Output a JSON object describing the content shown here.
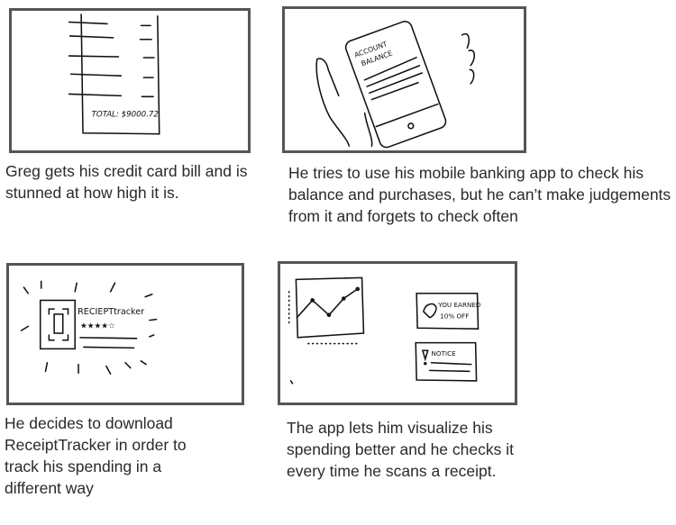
{
  "panels": [
    {
      "sketch_text": {
        "total": "TOTAL: $9000.72"
      },
      "caption": "Greg gets his credit card bill and is stunned at how high it is."
    },
    {
      "sketch_text": {
        "screen_title_1": "ACCOUNT",
        "screen_title_2": "BALANCE"
      },
      "caption": "He tries to use his mobile banking app to check his balance and purchases, but he can’t make judgements from it and forgets to check often"
    },
    {
      "sketch_text": {
        "app_name": "RECIEPTtracker",
        "rating": "★★★★☆"
      },
      "caption": "He decides to download ReceiptTracker in order to track his spending in a different way"
    },
    {
      "sketch_text": {
        "reward_1": "YOU EARNED",
        "reward_2": "10% OFF",
        "notice": "NOTICE"
      },
      "caption": "The app lets him visualize his spending better and he checks it every time he scans a receipt."
    }
  ],
  "colors": {
    "frame": "#555555",
    "text": "#2a2a2a"
  }
}
